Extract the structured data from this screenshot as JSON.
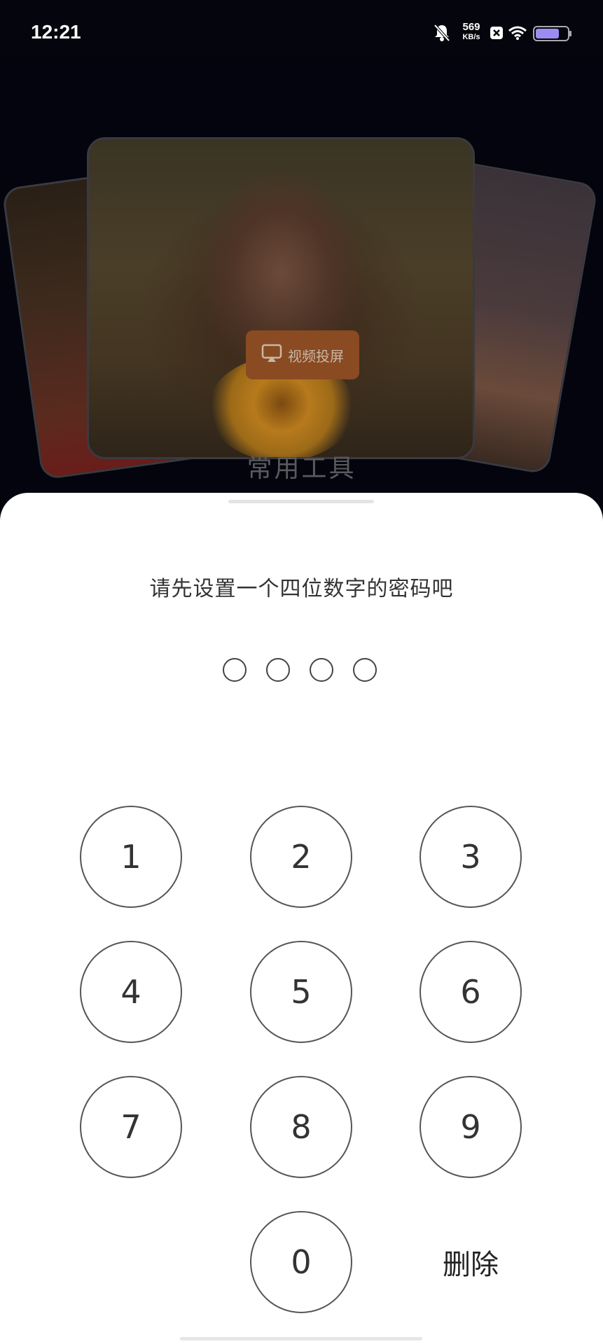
{
  "status_bar": {
    "time": "12:21",
    "net_speed_value": "569",
    "net_speed_unit": "KB/s",
    "battery_level": 0.75,
    "icons": [
      "mute-bell-icon",
      "close-box-icon",
      "wifi-icon",
      "battery-icon"
    ]
  },
  "background": {
    "cast_button_label": "视频投屏",
    "section_title": "常用工具"
  },
  "sheet": {
    "prompt": "请先设置一个四位数字的密码吧",
    "pin_length": 4,
    "keys": [
      "1",
      "2",
      "3",
      "4",
      "5",
      "6",
      "7",
      "8",
      "9",
      "0"
    ],
    "delete_label": "删除"
  },
  "colors": {
    "sheet_bg": "#ffffff",
    "key_border": "#555555",
    "cast_button": "#8a4a22",
    "screen_bg": "#03040c"
  }
}
